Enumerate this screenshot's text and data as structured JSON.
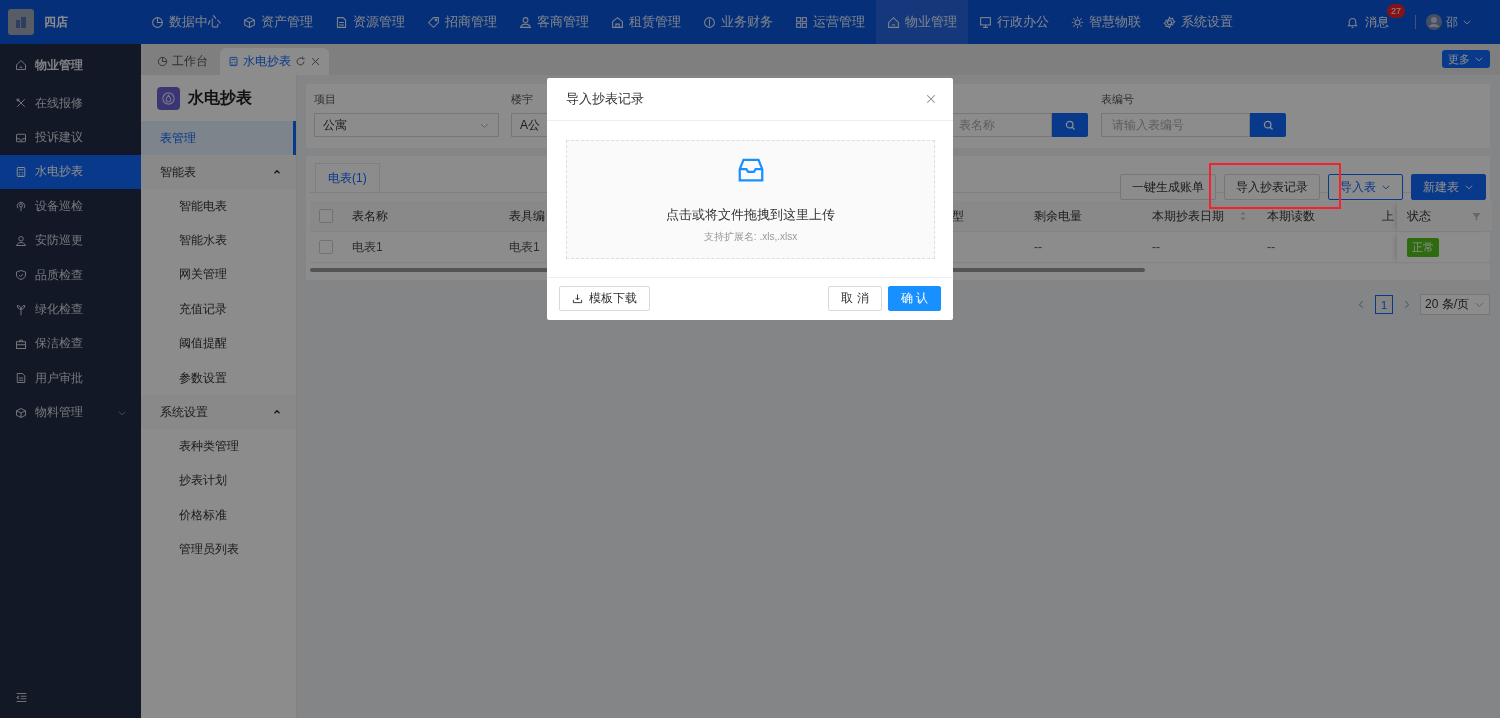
{
  "header": {
    "brand": "四店",
    "nav": [
      {
        "label": "数据中心",
        "selected": false
      },
      {
        "label": "资产管理",
        "selected": false
      },
      {
        "label": "资源管理",
        "selected": false
      },
      {
        "label": "招商管理",
        "selected": false
      },
      {
        "label": "客商管理",
        "selected": false
      },
      {
        "label": "租赁管理",
        "selected": false
      },
      {
        "label": "业务财务",
        "selected": false
      },
      {
        "label": "运营管理",
        "selected": false
      },
      {
        "label": "物业管理",
        "selected": true
      },
      {
        "label": "行政办公",
        "selected": false
      },
      {
        "label": "智慧物联",
        "selected": false
      },
      {
        "label": "系统设置",
        "selected": false
      }
    ],
    "messages": {
      "label": "消息",
      "badge": "27"
    },
    "user": {
      "name": "邵"
    }
  },
  "sidebar": {
    "title": "物业管理",
    "items": [
      {
        "label": "在线报修",
        "selected": false
      },
      {
        "label": "投诉建议",
        "selected": false
      },
      {
        "label": "水电抄表",
        "selected": true
      },
      {
        "label": "设备巡检",
        "selected": false
      },
      {
        "label": "安防巡更",
        "selected": false
      },
      {
        "label": "品质检查",
        "selected": false
      },
      {
        "label": "绿化检查",
        "selected": false
      },
      {
        "label": "保洁检查",
        "selected": false
      },
      {
        "label": "用户审批",
        "selected": false
      },
      {
        "label": "物料管理",
        "selected": false,
        "expandable": true
      }
    ]
  },
  "tabs": [
    {
      "label": "工作台",
      "selected": false
    },
    {
      "label": "水电抄表",
      "selected": true
    }
  ],
  "more_button": "更多",
  "submenu": {
    "title": "水电抄表",
    "items": [
      {
        "kind": "item",
        "label": "表管理",
        "selected": true
      },
      {
        "kind": "group",
        "label": "智能表",
        "expanded": true,
        "children": [
          {
            "label": "智能电表",
            "selected": false
          },
          {
            "label": "智能水表",
            "selected": false
          },
          {
            "label": "网关管理",
            "selected": false
          },
          {
            "label": "充值记录",
            "selected": false
          },
          {
            "label": "阈值提醒",
            "selected": false
          },
          {
            "label": "参数设置",
            "selected": false
          }
        ]
      },
      {
        "kind": "group",
        "label": "系统设置",
        "expanded": true,
        "children": [
          {
            "label": "表种类管理",
            "selected": false
          },
          {
            "label": "抄表计划",
            "selected": false
          },
          {
            "label": "价格标准",
            "selected": false
          },
          {
            "label": "管理员列表",
            "selected": false
          }
        ]
      }
    ]
  },
  "filters": [
    {
      "kind": "select",
      "label": "项目",
      "value": "公寓"
    },
    {
      "kind": "select",
      "label": "楼宇",
      "value": "A公"
    },
    {
      "kind": "search",
      "placeholder": "表名称"
    },
    {
      "kind": "search",
      "label": "表编号",
      "placeholder": "请输入表编号"
    }
  ],
  "table_tabs": [
    {
      "label": "电表(1)",
      "selected": true
    }
  ],
  "toolbar": [
    {
      "label": "一键生成账单",
      "kind": "default",
      "highlighted": false
    },
    {
      "label": "导入抄表记录",
      "kind": "default",
      "highlighted": true
    },
    {
      "label": "导入表",
      "kind": "outline",
      "highlighted": false
    },
    {
      "label": "新建表",
      "kind": "primary",
      "highlighted": false
    }
  ],
  "table": {
    "checked": false,
    "columns": [
      {
        "label": "表名称"
      },
      {
        "label": "表具编"
      },
      {
        "label": "型"
      },
      {
        "label": "剩余电量"
      },
      {
        "label": "本期抄表日期",
        "sortable": true
      },
      {
        "label": "本期读数"
      },
      {
        "label": "上"
      },
      {
        "label": "状态",
        "filterable": true
      }
    ],
    "rows": [
      {
        "checked": false,
        "cells": [
          "电表1",
          "电表1",
          null,
          "--",
          "--",
          "--",
          null,
          "正常"
        ]
      }
    ]
  },
  "pagination": {
    "pages": [
      {
        "label": "1",
        "selected": true
      }
    ],
    "page_size": "20 条/页"
  },
  "modal": {
    "title": "导入抄表记录",
    "upload_text": "点击或将文件拖拽到这里上传",
    "upload_hint": "支持扩展名: .xls,.xlsx",
    "template_button": "模板下载",
    "cancel_button": "取 消",
    "confirm_button": "确 认"
  }
}
